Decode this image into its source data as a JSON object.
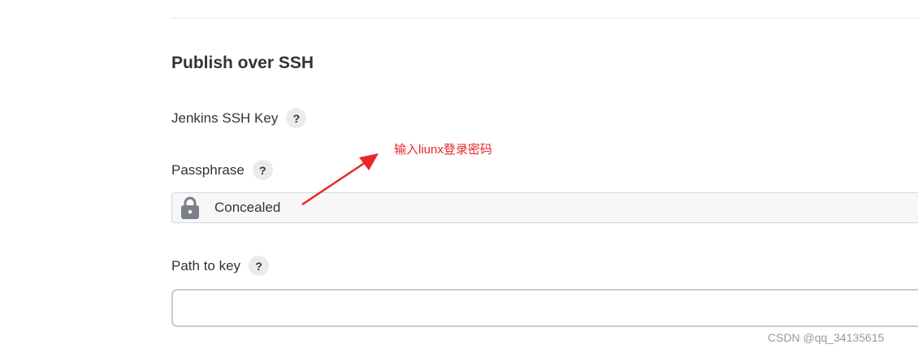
{
  "section": {
    "title": "Publish over SSH"
  },
  "fields": {
    "ssh_key": {
      "label": "Jenkins SSH Key",
      "help": "?"
    },
    "passphrase": {
      "label": "Passphrase",
      "help": "?",
      "value": "Concealed"
    },
    "path_to_key": {
      "label": "Path to key",
      "help": "?",
      "value": ""
    }
  },
  "annotation": {
    "text": "输入liunx登录密码",
    "color": "#e8262c"
  },
  "watermark": "CSDN @qq_34135615",
  "icons": {
    "lock": "lock-icon",
    "help": "help-icon",
    "arrow": "arrow-icon"
  }
}
